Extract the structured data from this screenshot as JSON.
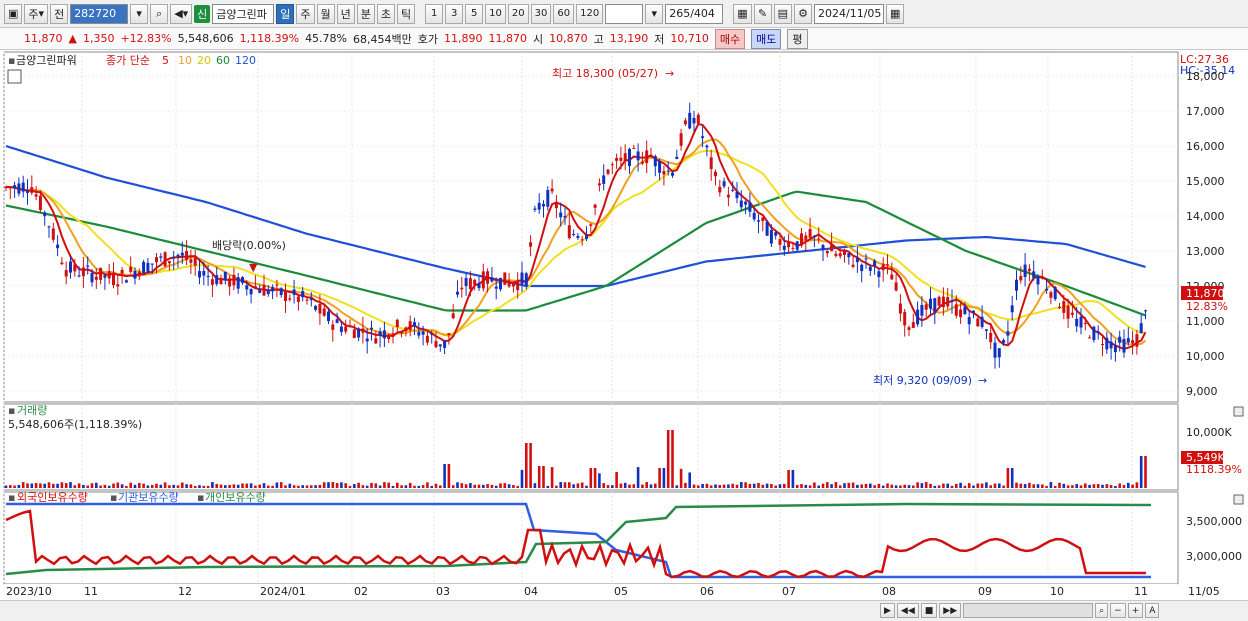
{
  "toolbar": {
    "market": "주",
    "prev_label": "전",
    "code": "282720",
    "new_badge": "신",
    "name": "금양그린파",
    "periods": [
      "일",
      "주",
      "월",
      "년",
      "분",
      "초",
      "틱"
    ],
    "active_period": "일",
    "intervals": [
      "1",
      "3",
      "5",
      "10",
      "20",
      "30",
      "60",
      "120"
    ],
    "page": "265",
    "page_total": "/404",
    "date": "2024/11/05"
  },
  "quote": {
    "price": "11,870",
    "change_arrow": "▲",
    "change": "1,350",
    "change_pct": "+12.83%",
    "volume": "5,548,606",
    "volume_pct": "1,118.39%",
    "turnover_pct": "45.78%",
    "amount": "68,454백만",
    "bid_label": "호가",
    "bid": "11,890",
    "ask": "11,870",
    "open_label": "시",
    "open": "10,870",
    "high_label": "고",
    "high": "13,190",
    "low_label": "저",
    "low": "10,710",
    "buy_label": "매수",
    "sell_label": "매도",
    "avg_label": "평"
  },
  "price_panel": {
    "name": "금양그린파워",
    "indicator": "종가 단순",
    "ma_labels": [
      "5",
      "10",
      "20",
      "60",
      "120"
    ],
    "lc": "LC:27.36",
    "hc": "HC:-35.14",
    "high_note": "최고 18,300 (05/27)",
    "low_note": "최저 9,320 (09/09)",
    "dividend_note": "배당락(0.00%)",
    "y_ticks": [
      "18,000",
      "17,000",
      "16,000",
      "15,000",
      "14,000",
      "13,000",
      "12,000",
      "11,000",
      "10,000",
      "9,000"
    ],
    "last_price_tag": "11,870",
    "last_pct_tag": "12.83%"
  },
  "volume_panel": {
    "title": "거래량",
    "value": "5,548,606주(1,118.39%)",
    "y_tick": "10,000K",
    "last_tag": "5,549K",
    "last_pct": "1118.39%"
  },
  "holdings_panel": {
    "series": [
      "외국인보유수량",
      "기관보유수량",
      "개인보유수량"
    ],
    "y_ticks": [
      "3,500,000",
      "3,000,000"
    ]
  },
  "x_axis": [
    "2023/10",
    "11",
    "12",
    "2024/01",
    "02",
    "03",
    "04",
    "05",
    "06",
    "07",
    "08",
    "09",
    "10",
    "11",
    "11/05"
  ],
  "colors": {
    "up": "#d01010",
    "down": "#1030c0",
    "ma5": "#d01010",
    "ma10": "#f0a020",
    "ma20": "#f0e020",
    "ma60": "#1a8c3a",
    "ma120": "#2050d8",
    "foreign": "#d01010",
    "institution": "#3060e0",
    "individual": "#2a8a4a"
  }
}
